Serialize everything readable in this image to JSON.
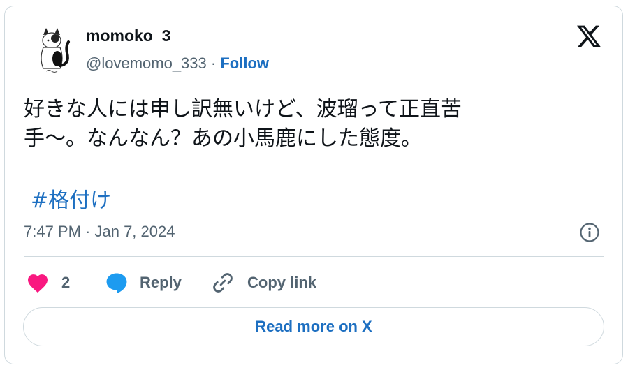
{
  "author": {
    "display_name": "momoko_3",
    "handle": "@lovemomo_333",
    "separator": " · ",
    "follow_label": "Follow",
    "avatar_icon": "cat-avatar-icon"
  },
  "platform_icon": "x-logo-icon",
  "tweet": {
    "text_line1": "好きな人には申し訳無いけど、波瑠って正直苦",
    "text_line2": "手〜。なんなん？あの小馬鹿にした態度。",
    "hashtag": "#格付け",
    "timestamp": "7:47 PM · Jan 7, 2024"
  },
  "actions": {
    "like_count": "2",
    "reply_label": "Reply",
    "copy_link_label": "Copy link"
  },
  "read_more_label": "Read more on X",
  "colors": {
    "accent": "#1d6fc1",
    "like": "#f91880",
    "reply": "#1d9bf0",
    "muted": "#536471",
    "border": "#cfd9de"
  }
}
